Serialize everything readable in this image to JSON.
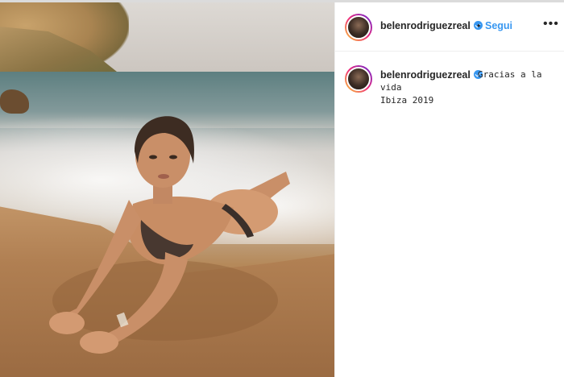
{
  "post": {
    "username": "belenrodriguezreal",
    "follow_label": "Segui",
    "separator": "•",
    "more_icon": "more-horizontal-icon",
    "caption_line1": "Gracias a la",
    "caption_line2": "vida",
    "caption_line3": "Ibiza 2019"
  },
  "colors": {
    "accent": "#3897f0",
    "text": "#262626",
    "border": "#efefef"
  }
}
